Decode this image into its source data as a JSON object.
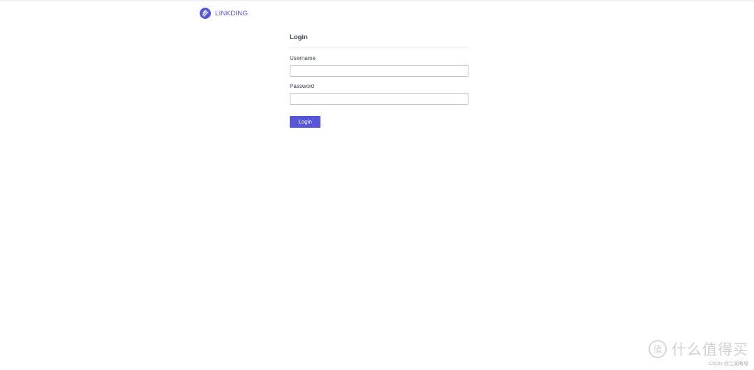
{
  "app": {
    "brand_name": "LINKDING",
    "brand_icon": "linkding-logo-icon",
    "accent_color": "#5755d9"
  },
  "login": {
    "title": "Login",
    "username_label": "Username",
    "username_value": "",
    "password_label": "Password",
    "password_value": "",
    "submit_label": "Login"
  },
  "watermark": {
    "text": "什么值得买",
    "credit": "CSDN @江湖有缘",
    "icon": "smzdm-logo-icon"
  }
}
